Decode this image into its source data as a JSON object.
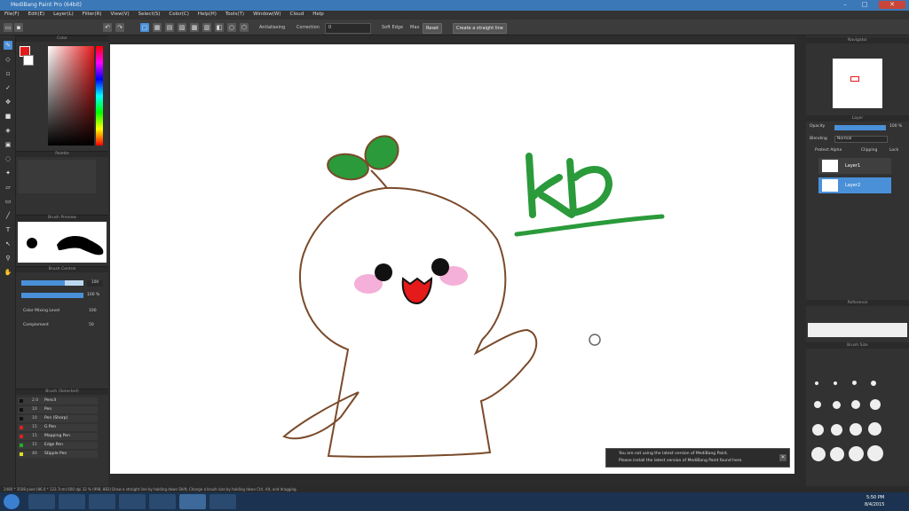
{
  "window": {
    "title": "MediBang Paint Pro (64bit)",
    "minimize": "–",
    "maximize": "□",
    "close": "✕"
  },
  "menu": [
    "File(F)",
    "Edit(E)",
    "Layer(L)",
    "Filter(R)",
    "View(V)",
    "Select(S)",
    "Color(C)",
    "Help(H)",
    "Tools(T)",
    "Window(W)",
    "Cloud",
    "Help"
  ],
  "toolbar": {
    "antialias_label": "Antialiasing",
    "correction_label": "Correction",
    "correction_value": "0",
    "soft_edge_label": "Soft Edge",
    "max_label": "Max",
    "reset_label": "Reset",
    "create_label": "Create a straight line"
  },
  "left_tools": [
    "brush-tool",
    "eraser-tool",
    "dot-tool",
    "select-tool",
    "move-tool",
    "fill-tool",
    "bucket-tool",
    "gradation-tool",
    "lasso-tool",
    "magic-wand-tool",
    "select-pen-tool",
    "select-eraser-tool",
    "divide-tool",
    "text-tool",
    "operation-tool",
    "eyedropper-tool",
    "hand-tool"
  ],
  "panels": {
    "color": "Color",
    "palette": "Palette",
    "brush_preview": "Brush Preview",
    "brush_control": "Brush Control",
    "brush_size_value": "100",
    "brush_opacity_value": "100 %",
    "color_mixing_label": "Color Mixing Level",
    "color_mixing_value": "100",
    "complement_label": "Complement",
    "complement_value": "50",
    "brush_list": "Brush (Selected)",
    "brushes": [
      {
        "size": "2.0",
        "name": "Pencil",
        "color": "#111111"
      },
      {
        "size": "10",
        "name": "Pen",
        "color": "#111111"
      },
      {
        "size": "10",
        "name": "Pen (Sharp)",
        "color": "#111111"
      },
      {
        "size": "15",
        "name": "G Pen",
        "color": "#e02020"
      },
      {
        "size": "15",
        "name": "Mapping Pen",
        "color": "#e02020"
      },
      {
        "size": "15",
        "name": "Edge Pen",
        "color": "#20b020"
      },
      {
        "size": "40",
        "name": "Stipple Pen",
        "color": "#e0e020"
      }
    ]
  },
  "right": {
    "navigator": "Navigator",
    "layer_panel": "Layer",
    "opacity_label": "Opacity",
    "opacity_value": "100 %",
    "blending_label": "Blending",
    "blending_value": "Normal",
    "protect_alpha": "Protect Alpha",
    "clipping": "Clipping",
    "lock": "Lock",
    "layers": [
      {
        "name": "Layer1",
        "selected": false
      },
      {
        "name": "Layer2",
        "selected": true
      }
    ],
    "reference": "Reference",
    "brush_size": "Brush Size"
  },
  "canvas": {
    "handwritten_text": "kb"
  },
  "notification": {
    "line1": "You are not using the latest version of MediBang Paint.",
    "line2": "Please install the latest version of MediBang Paint found here.",
    "close": "✕"
  },
  "status": "2480 * 3508 pixel  (86.0 * 123.7cm)  600 dpi  32 %  (998, 883)  Draw a straight line by holding down Shift, Change a brush size by holding down Ctrl, Alt, and dragging.",
  "clock": {
    "time": "5:50 PM",
    "date": "8/4/2015"
  },
  "colors": {
    "accent": "#4a90d9",
    "sprout": "#2a9a3a",
    "outline": "#7a4a2a",
    "blush": "#f4b0d8",
    "mouth": "#e51a1a"
  }
}
